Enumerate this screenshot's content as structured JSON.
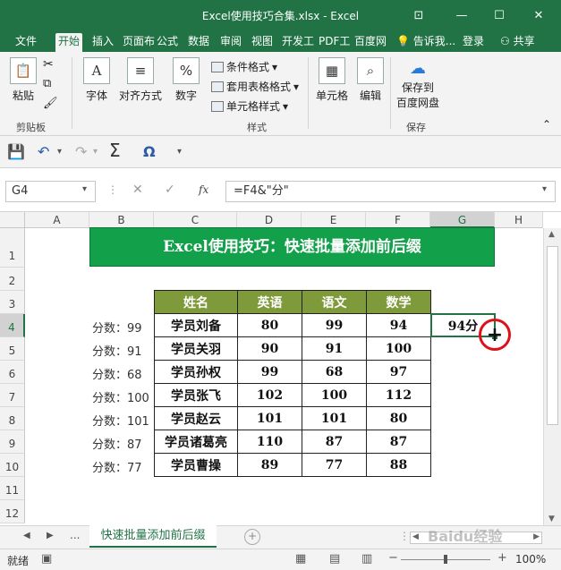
{
  "window": {
    "title": "Excel使用技巧合集.xlsx - Excel",
    "minimize": "—",
    "restore": "☐",
    "close": "✕"
  },
  "tabs": [
    "文件",
    "开始",
    "插入",
    "页面布",
    "公式",
    "数据",
    "审阅",
    "视图",
    "开发工",
    "PDF工",
    "百度网"
  ],
  "tell_me": "告诉我...",
  "login": "登录",
  "share": "共享",
  "ribbon": {
    "paste": "粘贴",
    "font": "字体",
    "align": "对齐方式",
    "number": "数字",
    "cond_format": "条件格式",
    "table_format": "套用表格格式",
    "cell_style": "单元格样式",
    "cells": "单元格",
    "edit": "编辑",
    "save_baidu_1": "保存到",
    "save_baidu_2": "百度网盘",
    "grp_clipboard": "剪贴板",
    "grp_style": "样式",
    "grp_save": "保存"
  },
  "formula": {
    "namebox": "G4",
    "fx": "fx",
    "content": "=F4&\"分\""
  },
  "columns": [
    "A",
    "B",
    "C",
    "D",
    "E",
    "F",
    "G",
    "H"
  ],
  "rows": [
    "1",
    "2",
    "3",
    "4",
    "5",
    "6",
    "7",
    "8",
    "9",
    "10",
    "11",
    "12"
  ],
  "sheet": {
    "banner": "Excel使用技巧：快速批量添加前后缀",
    "headers": [
      "姓名",
      "英语",
      "语文",
      "数学"
    ],
    "data": [
      {
        "label": "分数：99",
        "name": "学员刘备",
        "en": "80",
        "cn": "99",
        "math": "94"
      },
      {
        "label": "分数：91",
        "name": "学员关羽",
        "en": "90",
        "cn": "91",
        "math": "100"
      },
      {
        "label": "分数：68",
        "name": "学员孙权",
        "en": "99",
        "cn": "68",
        "math": "97"
      },
      {
        "label": "分数：100",
        "name": "学员张飞",
        "en": "102",
        "cn": "100",
        "math": "112"
      },
      {
        "label": "分数：101",
        "name": "学员赵云",
        "en": "101",
        "cn": "101",
        "math": "80"
      },
      {
        "label": "分数：87",
        "name": "学员诸葛亮",
        "en": "110",
        "cn": "87",
        "math": "87"
      },
      {
        "label": "分数：77",
        "name": "学员曹操",
        "en": "89",
        "cn": "77",
        "math": "88"
      }
    ],
    "g4": "94分"
  },
  "sheet_tab": "快速批量添加前后缀",
  "sheet_more": "...",
  "status": {
    "ready": "就绪",
    "zoom": "100%"
  },
  "watermark": "Baidu经验"
}
